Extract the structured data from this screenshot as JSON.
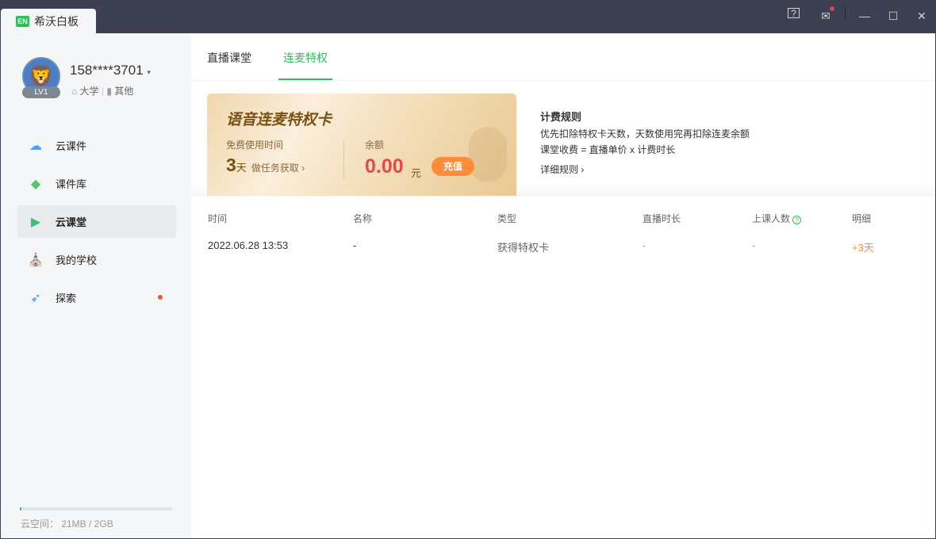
{
  "app": {
    "title": "希沃白板",
    "logo_text": "EN"
  },
  "window": {
    "help": "?",
    "mail": "✉",
    "minimize": "—",
    "maximize": "☐",
    "close": "✕"
  },
  "user": {
    "phone": "158****3701",
    "level": "LV1",
    "stage": "大学",
    "subject": "其他"
  },
  "nav": [
    {
      "label": "云课件",
      "icon": "cloud-icon"
    },
    {
      "label": "课件库",
      "icon": "library-icon"
    },
    {
      "label": "云课堂",
      "icon": "play-icon",
      "active": true
    },
    {
      "label": "我的学校",
      "icon": "school-icon"
    },
    {
      "label": "探索",
      "icon": "rocket-icon",
      "badge": true
    }
  ],
  "storage": {
    "label": "云空间：  21MB / 2GB",
    "used_fraction": 0.01
  },
  "tabs": [
    "直播课堂",
    "连麦特权"
  ],
  "card": {
    "title": "语音连麦特权卡",
    "free_label": "免费使用时间",
    "days": "3",
    "days_unit": "天",
    "task_link": "做任务获取 ›",
    "balance_label": "余额",
    "balance": "0.00",
    "currency": "元",
    "recharge": "充值"
  },
  "rules": {
    "title": "计费规则",
    "line1": "优先扣除特权卡天数，天数使用完再扣除连麦余额",
    "line2": "课堂收费 = 直播单价 x 计费时长",
    "link": "详细规则 ›"
  },
  "table": {
    "headers": [
      "时间",
      "名称",
      "类型",
      "直播时长",
      "上课人数",
      "明细"
    ],
    "rows": [
      [
        "2022.06.28 13:53",
        "-",
        "获得特权卡",
        "-",
        "-",
        "+3天"
      ]
    ]
  },
  "colors": {
    "accent": "#2fbf5a",
    "orange": "#ff8c3b"
  }
}
